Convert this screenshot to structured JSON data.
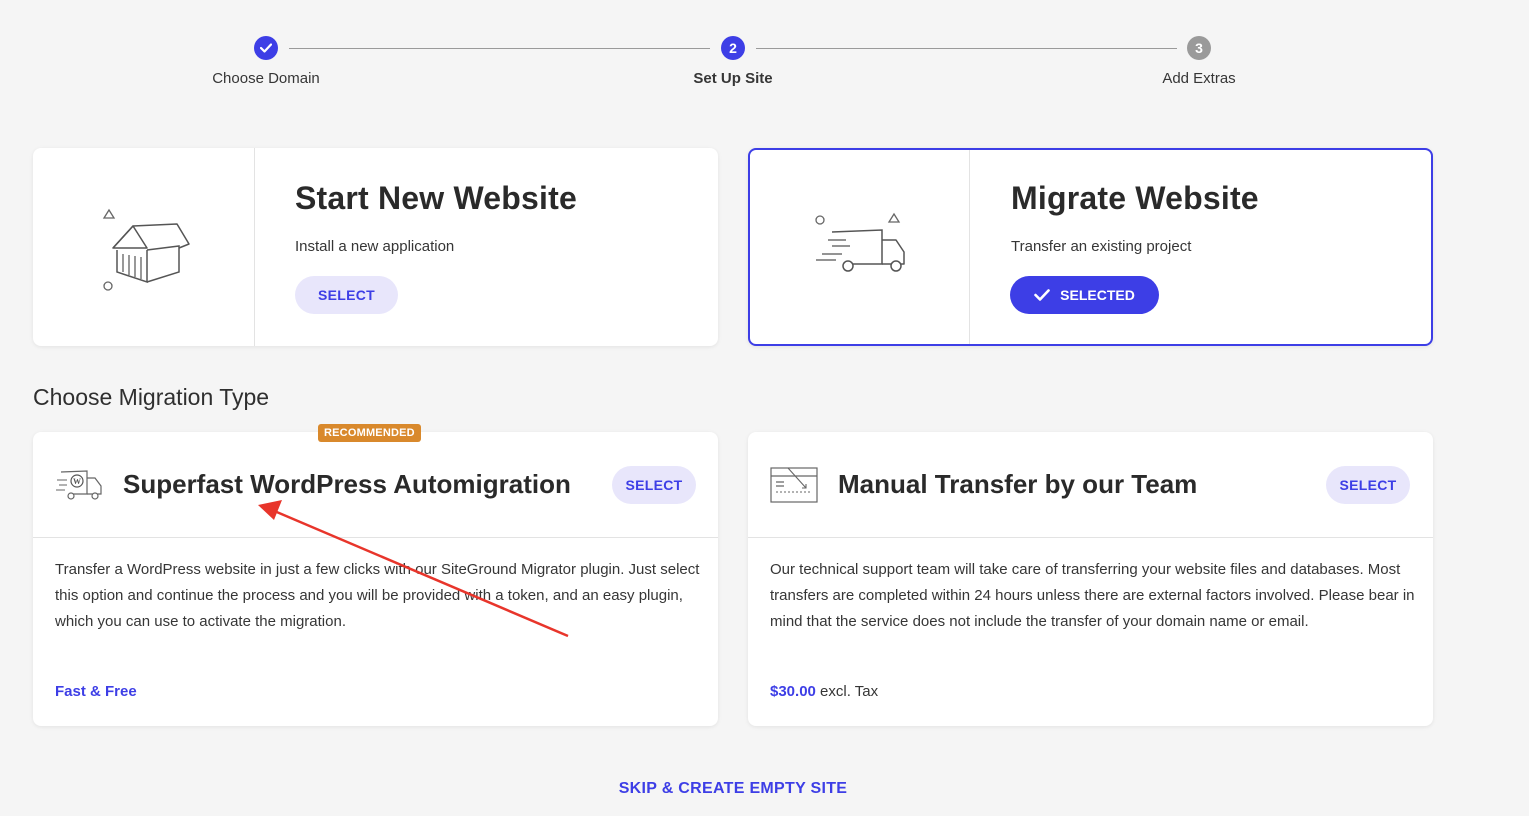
{
  "stepper": {
    "steps": [
      {
        "label": "Choose Domain",
        "number": "1",
        "state": "done"
      },
      {
        "label": "Set Up Site",
        "number": "2",
        "state": "current"
      },
      {
        "label": "Add Extras",
        "number": "3",
        "state": "upcoming"
      }
    ]
  },
  "site_options": [
    {
      "title": "Start New Website",
      "subtitle": "Install a new application",
      "button": "SELECT",
      "icon": "house-icon",
      "selected": false
    },
    {
      "title": "Migrate Website",
      "subtitle": "Transfer an existing project",
      "button": "SELECTED",
      "icon": "truck-icon",
      "selected": true
    }
  ],
  "migration": {
    "section_title": "Choose Migration Type",
    "options": [
      {
        "badge": "RECOMMENDED",
        "title": "Superfast WordPress Automigration",
        "button": "SELECT",
        "icon": "wordpress-truck-icon",
        "description": "Transfer a WordPress website in just a few clicks with our SiteGround Migrator plugin. Just select this option and continue the process and you will be provided with a token, and an easy plugin, which you can use to activate the migration.",
        "footer_accent": "Fast & Free",
        "footer_rest": ""
      },
      {
        "badge": "",
        "title": "Manual Transfer by our Team",
        "button": "SELECT",
        "icon": "browser-transfer-icon",
        "description": "Our technical support team will take care of transferring your website files and databases. Most transfers are completed within 24 hours unless there are external factors involved. Please bear in mind that the service does not include the transfer of your domain name or email.",
        "footer_accent": "$30.00",
        "footer_rest": " excl. Tax"
      }
    ]
  },
  "skip_link": "SKIP & CREATE EMPTY SITE",
  "colors": {
    "accent": "#3d3ee6",
    "badge": "#d9892c",
    "annotation_arrow": "#e8352b"
  }
}
